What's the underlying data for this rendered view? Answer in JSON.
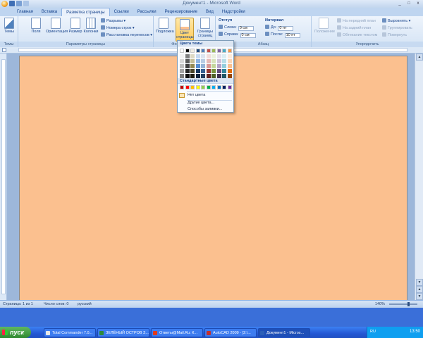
{
  "window": {
    "title": "Документ1 - Microsoft Word",
    "controls": [
      "_",
      "□",
      "x"
    ]
  },
  "tabs": [
    "Главная",
    "Вставка",
    "Разметка страницы",
    "Ссылки",
    "Рассылки",
    "Рецензирование",
    "Вид",
    "Надстройки"
  ],
  "ribbon": {
    "themes": {
      "button": "Темы",
      "label": "Темы"
    },
    "page_setup": {
      "label": "Параметры страницы",
      "margins": "Поля",
      "orientation": "Ориентация",
      "size": "Размер",
      "columns": "Колонки",
      "breaks": "Разрывы",
      "line_numbers": "Номера строк",
      "hyphenation": "Расстановка переносов"
    },
    "background": {
      "label": "Фон страницы",
      "watermark": "Подложка",
      "page_color": "Цвет страницы",
      "page_borders": "Границы страниц"
    },
    "paragraph": {
      "label": "Абзац",
      "indent_title": "Отступ",
      "left_label": "Слева:",
      "left_value": "0 см",
      "right_label": "Справа:",
      "right_value": "0 см",
      "spacing_title": "Интервал",
      "before_label": "До:",
      "before_value": "0 пт",
      "after_label": "После:",
      "after_value": "10 пт"
    },
    "arrange": {
      "label": "Упорядочить",
      "position": "Положение",
      "bring_front": "На передний план",
      "send_back": "На задний план",
      "text_wrap": "Обтекание текстом",
      "align": "Выровнять",
      "group": "Группировать",
      "rotate": "Повернуть"
    }
  },
  "dropdown": {
    "theme_colors_title": "Цвета темы",
    "standard_colors_title": "Стандартные цвета",
    "no_color": "Нет цвета",
    "more_colors": "Другие цвета...",
    "fill_effects": "Способы заливки...",
    "theme_top_row": [
      "#ffffff",
      "#000000",
      "#eeece1",
      "#1f497d",
      "#4f81bd",
      "#c0504d",
      "#9bbb59",
      "#8064a2",
      "#4bacc6",
      "#f79646"
    ],
    "theme_columns": [
      [
        "#f2f2f2",
        "#d8d8d8",
        "#bfbfbf",
        "#a5a5a5",
        "#7f7f7f"
      ],
      [
        "#7f7f7f",
        "#595959",
        "#3f3f3f",
        "#262626",
        "#0c0c0c"
      ],
      [
        "#ddd9c3",
        "#c4bd97",
        "#938953",
        "#494429",
        "#1d1b10"
      ],
      [
        "#c6d9f0",
        "#8db3e2",
        "#548dd4",
        "#17365d",
        "#0f243e"
      ],
      [
        "#dbe5f1",
        "#b8cce4",
        "#95b3d7",
        "#366092",
        "#244061"
      ],
      [
        "#f2dcdb",
        "#e5b9b7",
        "#d99694",
        "#953734",
        "#632423"
      ],
      [
        "#ebf1dd",
        "#d7e3bc",
        "#c3d69b",
        "#76923c",
        "#4f6128"
      ],
      [
        "#e5e0ec",
        "#ccc1d9",
        "#b2a2c7",
        "#5f497a",
        "#3f3151"
      ],
      [
        "#dbeef3",
        "#b7dde8",
        "#92cddc",
        "#31859b",
        "#205867"
      ],
      [
        "#fdeada",
        "#fbd5b5",
        "#fac08f",
        "#e36c09",
        "#974806"
      ]
    ],
    "standard": [
      "#c00000",
      "#ff0000",
      "#ffc000",
      "#ffff00",
      "#92d050",
      "#00b050",
      "#00b0f0",
      "#0070c0",
      "#002060",
      "#7030a0"
    ]
  },
  "document": {
    "page_color": "#fbc08f"
  },
  "status": {
    "page": "Страница: 1 из 1",
    "words": "Число слов: 0",
    "language": "русский",
    "zoom": "140%",
    "zoom_fraction": 0.7
  },
  "taskbar": {
    "start": "пуск",
    "tasks": [
      {
        "label": "Total Commander 7.0...",
        "color": "#e8e8e8"
      },
      {
        "label": "ЗЕЛЁНЫЙ ОСТРОВ З...",
        "color": "#2d8a3c"
      },
      {
        "label": "Ответы@Mail.Ru: К...",
        "color": "#e23a1a"
      },
      {
        "label": "AutoCAD 2009 - [2:\\...",
        "color": "#c23030"
      },
      {
        "label": "Документ1 - Micros...",
        "color": "#2b5fb8"
      }
    ],
    "lang": "RU",
    "clock": "13:50"
  }
}
